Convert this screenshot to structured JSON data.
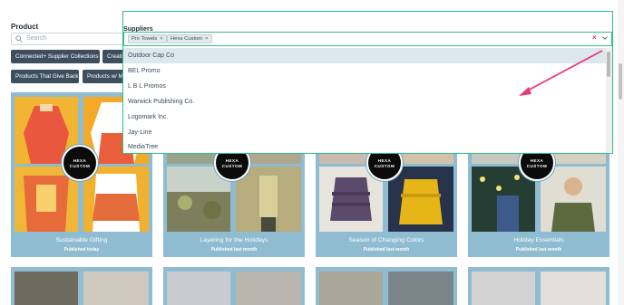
{
  "filters": {
    "product_label": "Product",
    "search_placeholder": "Search",
    "buttons": [
      "Connected+ Supplier Collections",
      "Creati",
      "Products That Give Back",
      "Products w/ Mi"
    ]
  },
  "suppliers": {
    "label": "Suppliers",
    "selected": [
      "Pro Towels",
      "Hexa Custom"
    ],
    "chip_remove": "×",
    "clear": "×",
    "options": [
      "Outdoor Cap Co",
      "BEL Promo",
      "L B L Promos",
      "Warwick Publishing Co.",
      "Logomark Inc.",
      "Jay-Line",
      "MediaTree"
    ],
    "highlighted_index": 0
  },
  "collections": [
    {
      "title": "Sustainable Gifting",
      "status": "Published today",
      "logo": "HEXA CUSTOM"
    },
    {
      "title": "Layering for the Holidays",
      "status": "Published last month",
      "logo": "HEXA CUSTOM"
    },
    {
      "title": "Season of Changing Colors",
      "status": "Published last month",
      "logo": "HEXA CUSTOM"
    },
    {
      "title": "Holiday Essentials",
      "status": "Published last month",
      "logo": "HEXA CUSTOM"
    }
  ],
  "colors": {
    "accent_green": "#2ec27e",
    "annotation_arrow": "#e8387a",
    "card_blue": "#8fbcd1",
    "pill_dark": "#3d4f5f"
  }
}
